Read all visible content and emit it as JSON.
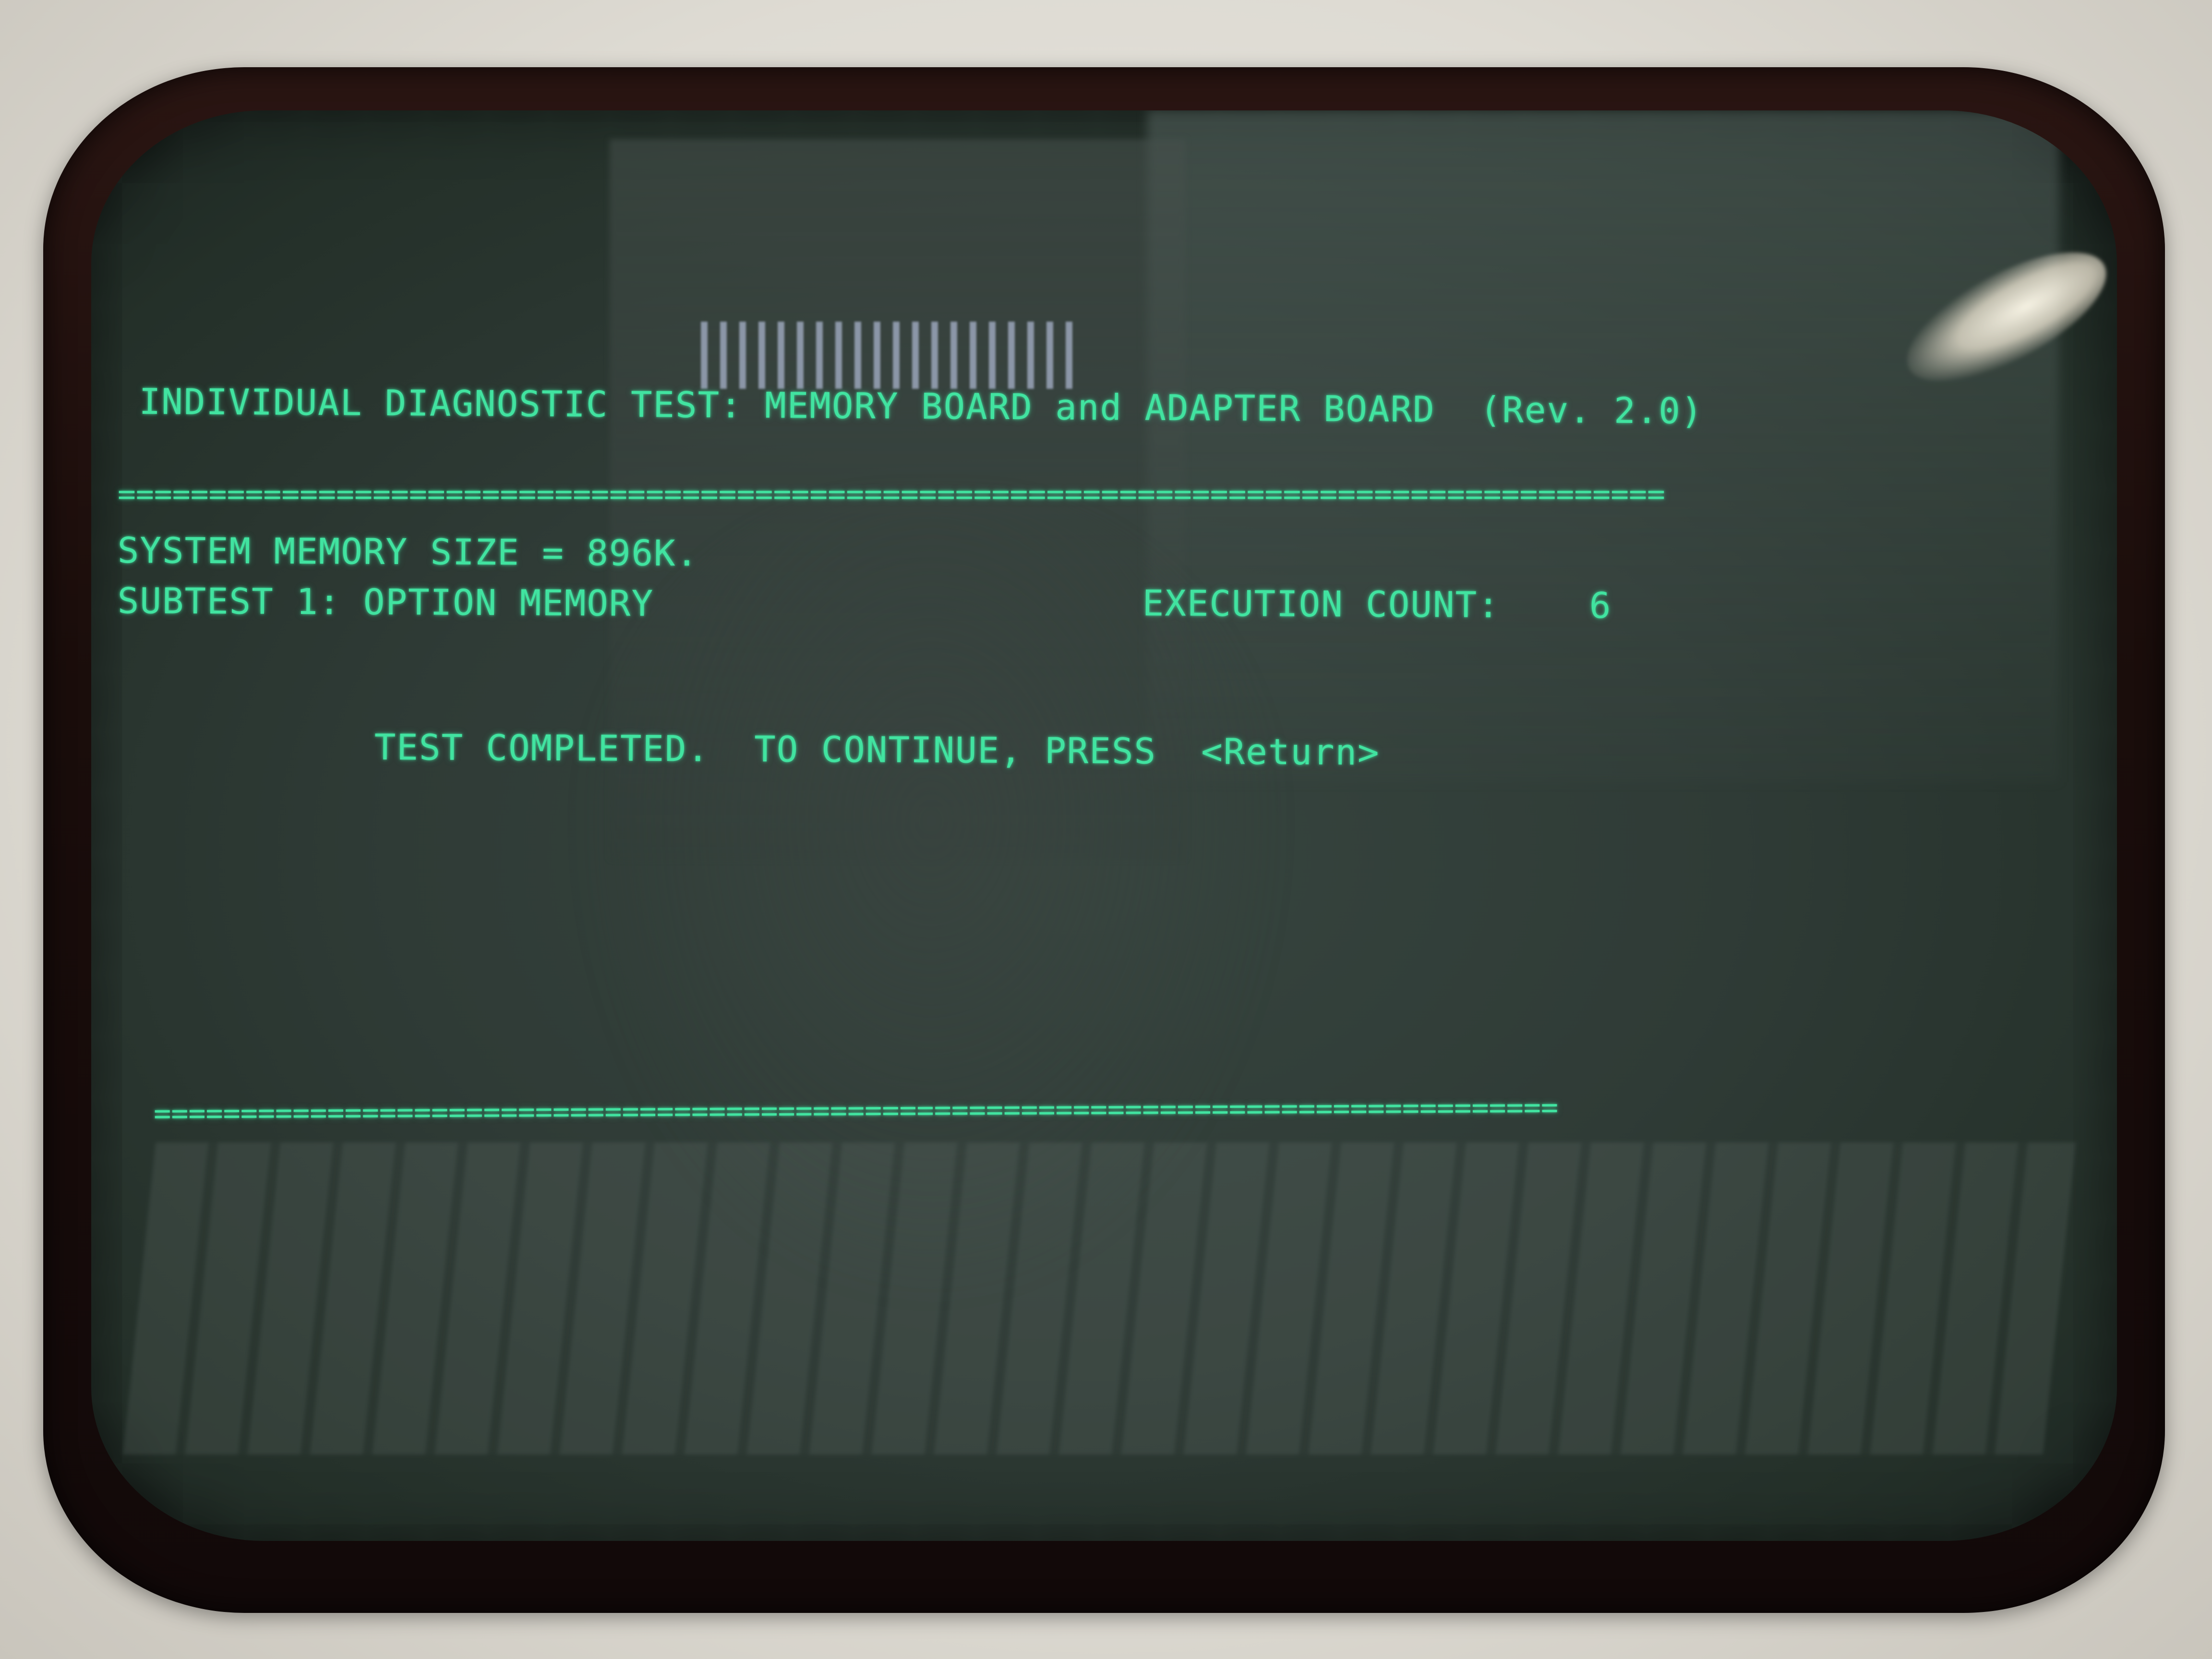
{
  "terminal": {
    "title": "INDIVIDUAL DIAGNOSTIC TEST: MEMORY BOARD and ADAPTER BOARD  (Rev. 2.0)",
    "divider_top": "=====================================================================================",
    "memory_size": "SYSTEM MEMORY SIZE = 896K.",
    "subtest": "SUBTEST 1: OPTION MEMORY",
    "execution_count_label": "EXECUTION COUNT:",
    "execution_count_value": "6",
    "status_message": "TEST COMPLETED.  TO CONTINUE, PRESS  <Return>",
    "divider_bottom": "================================================================================="
  },
  "colors": {
    "phosphor": "#41e3a0",
    "screen": "#2f3b36",
    "bezel": "#dedbd3"
  }
}
